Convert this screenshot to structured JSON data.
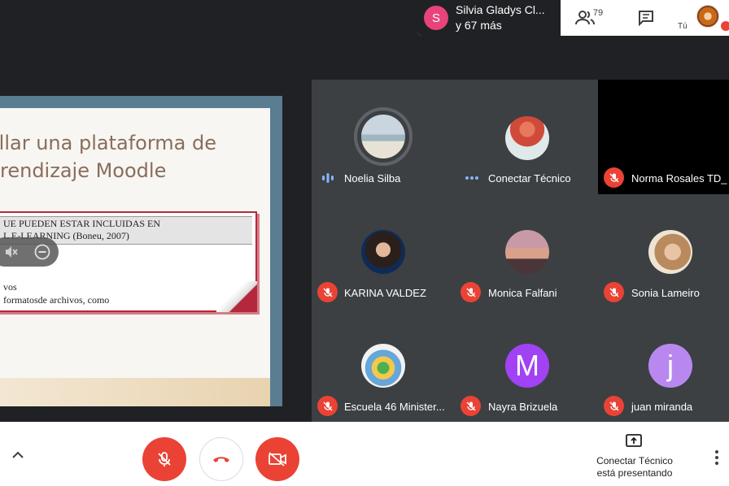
{
  "notification": {
    "initial": "S",
    "line1": "Silvia Gladys Cl...",
    "line2": "y 67 más"
  },
  "toolbar": {
    "participant_count": "79",
    "self_label": "Tú"
  },
  "presentation": {
    "title": "ollar una plataforma de\nrendizaje Moodle",
    "box_line1": "UE PUEDEN ESTAR INCLUIDAS EN",
    "box_line2": "L E-LEARNING (Boneu, 2007)",
    "box_line3": "vos",
    "box_line4": "formatosde archivos, como"
  },
  "participants": [
    {
      "name": "Noelia Silba",
      "status": "speaking"
    },
    {
      "name": "Conectar Técnico",
      "status": "presenting"
    },
    {
      "name": "Norma Rosales TD_",
      "status": "muted"
    },
    {
      "name": "KARINA VALDEZ",
      "status": "muted"
    },
    {
      "name": "Monica Falfani",
      "status": "muted"
    },
    {
      "name": "Sonia Lameiro",
      "status": "muted"
    },
    {
      "name": "Escuela 46 Minister...",
      "status": "muted"
    },
    {
      "name": "Nayra Brizuela",
      "status": "muted",
      "initial": "M"
    },
    {
      "name": "juan miranda",
      "status": "muted",
      "initial": "j"
    }
  ],
  "bottom": {
    "present_line1": "Conectar Técnico",
    "present_line2": "está presentando"
  },
  "colors": {
    "danger": "#ea4335",
    "tile": "#3c4043",
    "background": "#202124",
    "notify_avatar": "#e8437b",
    "letter_avatar": "#a142f4"
  }
}
